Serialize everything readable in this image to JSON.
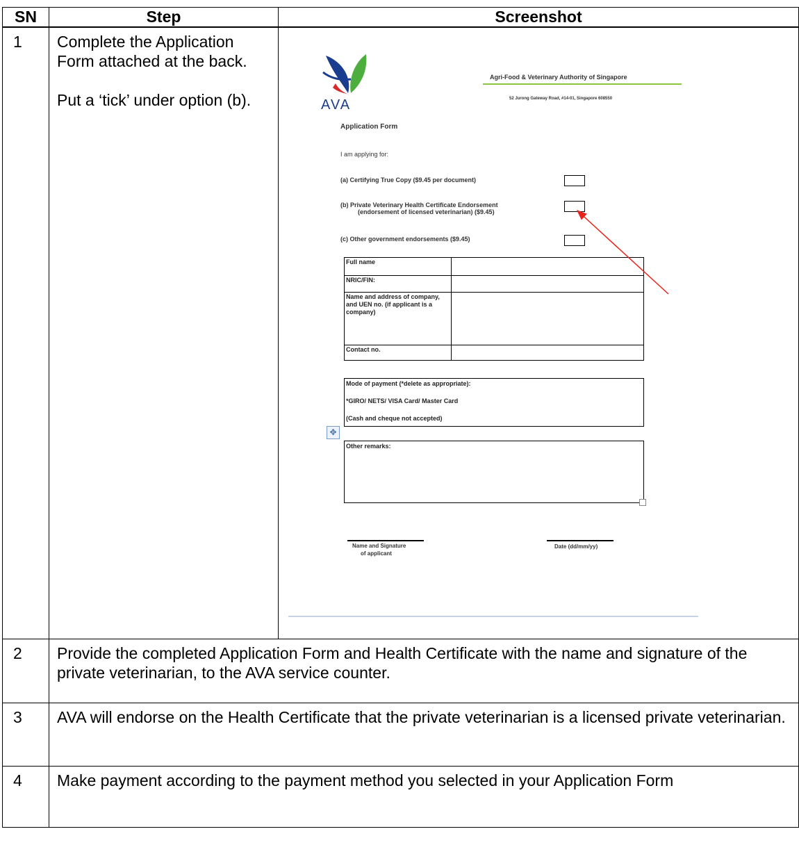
{
  "headers": {
    "sn": "SN",
    "step": "Step",
    "screenshot": "Screenshot"
  },
  "rows": [
    {
      "sn": "1",
      "step_line1": "Complete the Application Form attached at the back.",
      "step_line2": "Put a ‘tick’ under option (b)."
    },
    {
      "sn": "2",
      "text": "Provide the completed Application Form and Health Certificate with the name and signature of the private veterinarian, to the AVA service counter."
    },
    {
      "sn": "3",
      "text": "AVA will endorse on the Health Certificate that the private veterinarian is a licensed private veterinarian."
    },
    {
      "sn": "4",
      "text": "Make payment according to the payment method you selected in your Application Form"
    }
  ],
  "form": {
    "logo_text": "AVA",
    "agency": "Agri-Food & Veterinary Authority of Singapore",
    "address": "52 Jurong Gateway Road, #14-01, Singapore 608550",
    "title": "Application Form",
    "applying_for": "I am applying for:",
    "option_a": "(a) Certifying True Copy ($9.45 per document)",
    "option_b_line1": "(b) Private Veterinary Health Certificate Endorsement",
    "option_b_line2": "(endorsement of licensed veterinarian) ($9.45)",
    "option_c": "(c) Other government endorsements ($9.45)",
    "fields": [
      {
        "label": "Full name"
      },
      {
        "label": "NRIC/FIN:"
      },
      {
        "label": "Name and address of company, and UEN no. (if applicant is a company)"
      },
      {
        "label": "Contact no."
      }
    ],
    "payment_title": "Mode of payment (*delete as appropriate):",
    "payment_options": "*GIRO/ NETS/ VISA Card/ Master Card",
    "payment_note": "(Cash and cheque not accepted)",
    "remarks": "Other remarks:",
    "sig_label_line1": "Name and Signature",
    "sig_label_line2": "of applicant",
    "date_label": "Date (dd/mm/yy)",
    "accent_green": "#8cc63f",
    "arrow_color": "#e8231b"
  }
}
